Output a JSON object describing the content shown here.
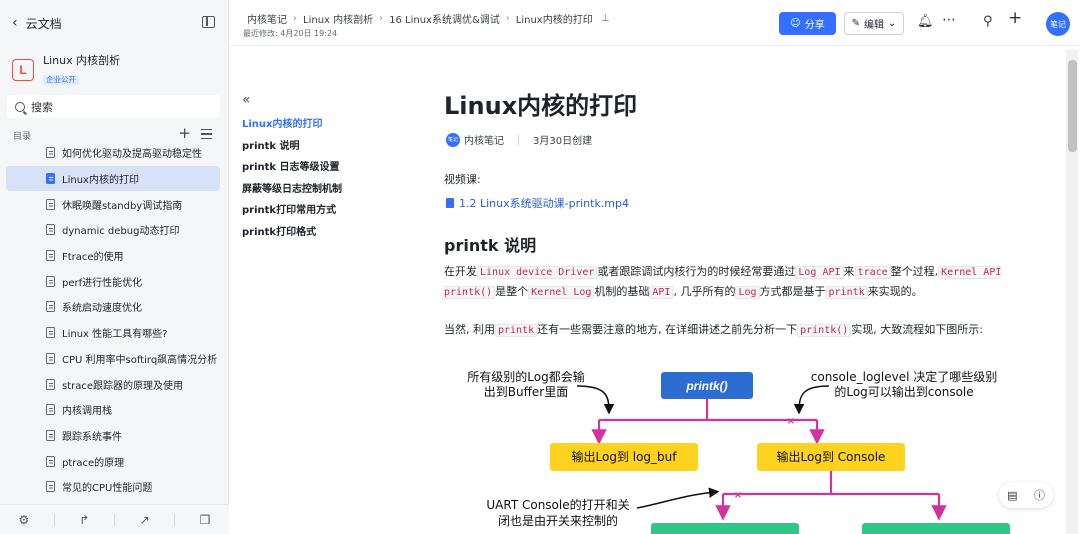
{
  "sidebar": {
    "back_label": "云文档",
    "kb_logo": "L",
    "kb_name": "Linux 内核剖析",
    "kb_badge": "企业公开",
    "search_placeholder": "搜索",
    "toc_label": "目录",
    "items": [
      {
        "label": "如何优化驱动及提高驱动稳定性"
      },
      {
        "label": "Linux内核的打印"
      },
      {
        "label": "休眠唤醒standby调试指南"
      },
      {
        "label": "dynamic debug动态打印"
      },
      {
        "label": "Ftrace的使用"
      },
      {
        "label": "perf进行性能优化"
      },
      {
        "label": "系统启动速度优化"
      },
      {
        "label": "Linux 性能工具有哪些?"
      },
      {
        "label": "CPU 利用率中softirq飙高情况分析"
      },
      {
        "label": "strace跟踪器的原理及使用"
      },
      {
        "label": "内核调用栈"
      },
      {
        "label": "跟踪系统事件"
      },
      {
        "label": "ptrace的原理"
      },
      {
        "label": "常见的CPU性能问题"
      }
    ]
  },
  "topbar": {
    "breadcrumbs": [
      "内核笔记",
      "Linux 内核剖析",
      "16 Linux系统调优&调试",
      "Linux内核的打印"
    ],
    "modified": "最近修改: 4月20日 19:24",
    "share_label": "分享",
    "edit_label": "编辑",
    "avatar_text": "笔记"
  },
  "outline": {
    "items": [
      "Linux内核的打印",
      "printk 说明",
      "printk 日志等级设置",
      "屏蔽等级日志控制机制",
      "printk打印常用方式",
      "printk打印格式"
    ]
  },
  "doc": {
    "title": "Linux内核的打印",
    "author_avatar": "笔记",
    "author": "内核笔记",
    "created": "3月30日创建",
    "video_label": "视频课:",
    "video_link": "1.2 Linux系统驱动课-printk.mp4",
    "h2": "printk 说明",
    "p1": {
      "t1": "在开发",
      "c1": "Linux device Driver",
      "t2": "或者跟踪调试内核行为的时候经常要通过",
      "c2": "Log API",
      "t3": "来",
      "c3": "trace",
      "t4": "整个过程,",
      "c4": "Kernel API printk()",
      "t5": "是整个",
      "c5": "Kernel Log",
      "t6": "机制的基础",
      "c6": "API",
      "t7": ", 几乎所有的",
      "c7": "Log",
      "t8": "方式都是基于",
      "c8": "printk",
      "t9": "来实现的。"
    },
    "p2": {
      "t1": "当然, 利用",
      "c1": "printk",
      "t2": "还有一些需要注意的地方, 在详细讲述之前先分析一下",
      "c2": "printk()",
      "t3": "实现, 大致流程如下图所示:"
    }
  },
  "diagram": {
    "note_left_1": "所有级别的Log都会输",
    "note_left_2": "出到Buffer里面",
    "printk_box": "printk()",
    "note_right_1": "console_loglevel 决定了哪些级别",
    "note_right_2": "的Log可以输出到console",
    "logbuf_box": "输出Log到 log_buf",
    "console_box": "输出Log到 Console",
    "uart_note_1": "UART Console的打开和关",
    "uart_note_2": "闭也是由开关来控制的",
    "colors": {
      "blue_box": "#2b6dd1",
      "yellow_box": "#ffd21f",
      "green_box": "#2fc787",
      "arrow": "#d4339e"
    }
  }
}
